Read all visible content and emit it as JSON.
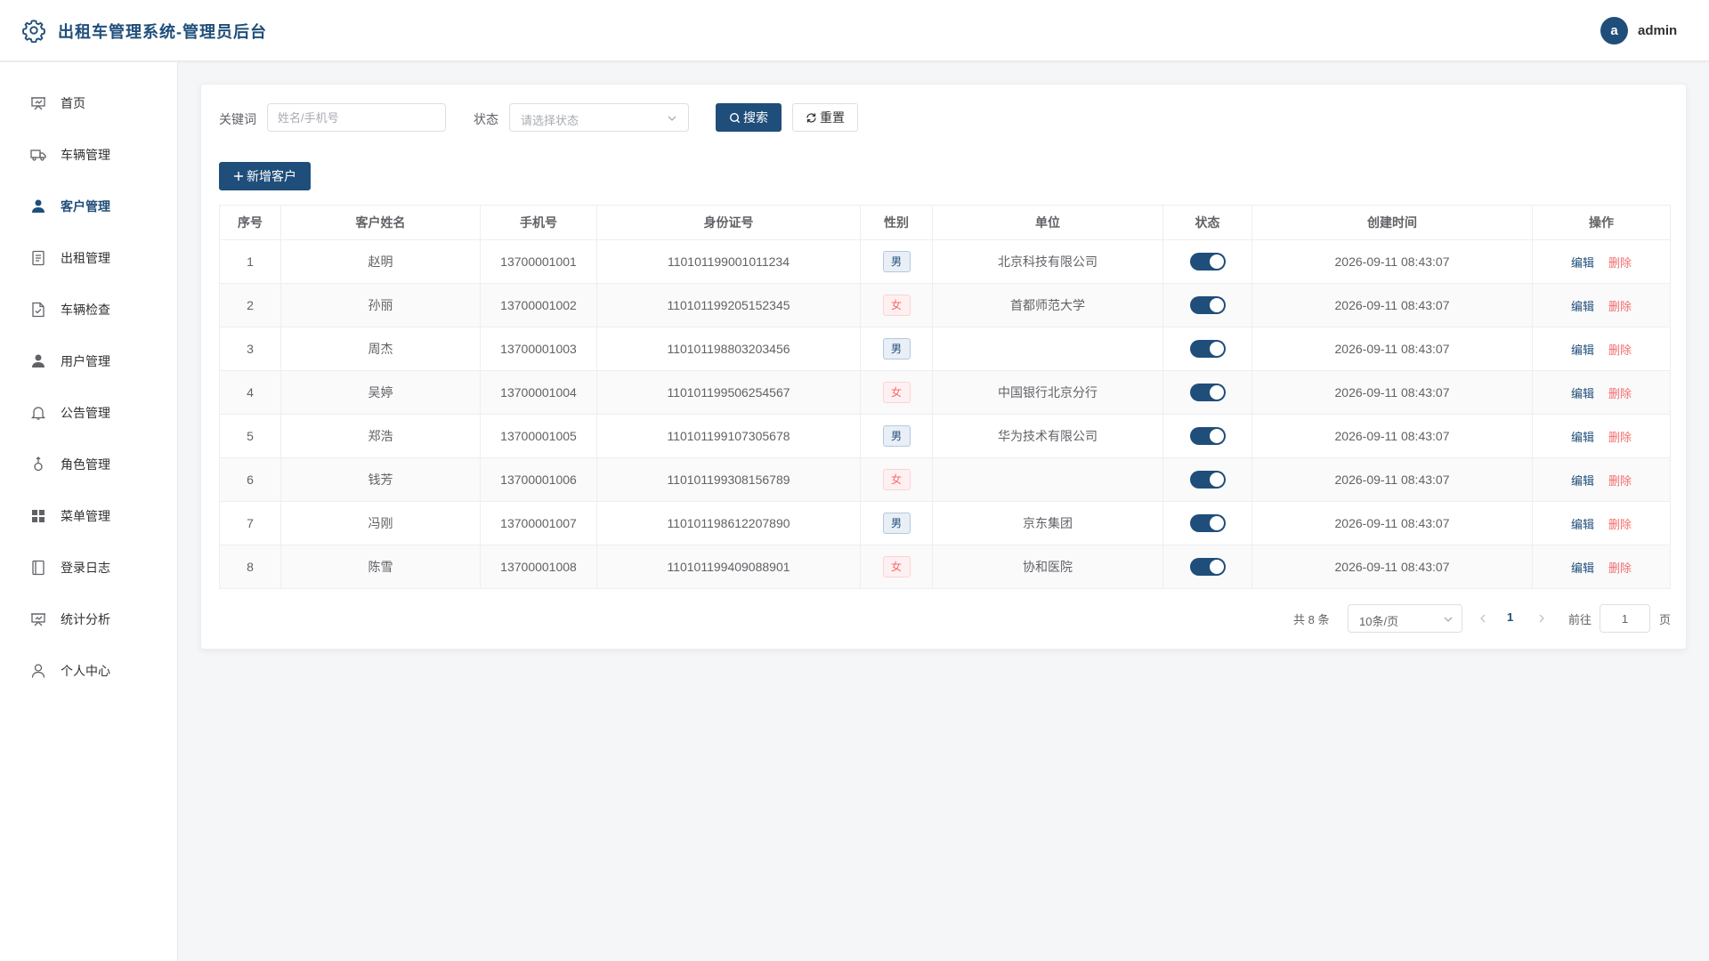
{
  "header": {
    "title": "出租车管理系统-管理员后台",
    "avatar_letter": "a",
    "username": "admin"
  },
  "sidebar": {
    "items": [
      {
        "label": "首页",
        "icon": "dashboard-icon"
      },
      {
        "label": "车辆管理",
        "icon": "truck-icon"
      },
      {
        "label": "客户管理",
        "icon": "user-icon",
        "active": true
      },
      {
        "label": "出租管理",
        "icon": "document-icon"
      },
      {
        "label": "车辆检查",
        "icon": "file-check-icon"
      },
      {
        "label": "用户管理",
        "icon": "user-icon"
      },
      {
        "label": "公告管理",
        "icon": "bell-icon"
      },
      {
        "label": "角色管理",
        "icon": "female-icon"
      },
      {
        "label": "菜单管理",
        "icon": "grid-icon"
      },
      {
        "label": "登录日志",
        "icon": "notebook-icon"
      },
      {
        "label": "统计分析",
        "icon": "presentation-icon"
      },
      {
        "label": "个人中心",
        "icon": "user-outline-icon"
      }
    ]
  },
  "search": {
    "keyword_label": "关键词",
    "keyword_placeholder": "姓名/手机号",
    "status_label": "状态",
    "status_placeholder": "请选择状态",
    "search_button": "搜索",
    "reset_button": "重置"
  },
  "add_button": "新增客户",
  "table": {
    "columns": [
      "序号",
      "客户姓名",
      "手机号",
      "身份证号",
      "性别",
      "单位",
      "状态",
      "创建时间",
      "操作"
    ],
    "edit_label": "编辑",
    "delete_label": "删除",
    "rows": [
      {
        "no": "1",
        "name": "赵明",
        "phone": "13700001001",
        "id_card": "110101199001011234",
        "gender": "男",
        "org": "北京科技有限公司",
        "enabled": true,
        "created": "2026-09-11 08:43:07"
      },
      {
        "no": "2",
        "name": "孙丽",
        "phone": "13700001002",
        "id_card": "110101199205152345",
        "gender": "女",
        "org": "首都师范大学",
        "enabled": true,
        "created": "2026-09-11 08:43:07"
      },
      {
        "no": "3",
        "name": "周杰",
        "phone": "13700001003",
        "id_card": "110101198803203456",
        "gender": "男",
        "org": "",
        "enabled": true,
        "created": "2026-09-11 08:43:07"
      },
      {
        "no": "4",
        "name": "吴婷",
        "phone": "13700001004",
        "id_card": "110101199506254567",
        "gender": "女",
        "org": "中国银行北京分行",
        "enabled": true,
        "created": "2026-09-11 08:43:07"
      },
      {
        "no": "5",
        "name": "郑浩",
        "phone": "13700001005",
        "id_card": "110101199107305678",
        "gender": "男",
        "org": "华为技术有限公司",
        "enabled": true,
        "created": "2026-09-11 08:43:07"
      },
      {
        "no": "6",
        "name": "钱芳",
        "phone": "13700001006",
        "id_card": "110101199308156789",
        "gender": "女",
        "org": "",
        "enabled": true,
        "created": "2026-09-11 08:43:07"
      },
      {
        "no": "7",
        "name": "冯刚",
        "phone": "13700001007",
        "id_card": "110101198612207890",
        "gender": "男",
        "org": "京东集团",
        "enabled": true,
        "created": "2026-09-11 08:43:07"
      },
      {
        "no": "8",
        "name": "陈雪",
        "phone": "13700001008",
        "id_card": "110101199409088901",
        "gender": "女",
        "org": "协和医院",
        "enabled": true,
        "created": "2026-09-11 08:43:07"
      }
    ]
  },
  "pagination": {
    "total_text": "共 8 条",
    "page_size": "10条/页",
    "current_page": "1",
    "goto_label": "前往",
    "goto_value": "1",
    "page_suffix": "页"
  },
  "colors": {
    "primary": "#1f4e7a",
    "danger": "#f56c6c",
    "background": "#f5f6f8"
  }
}
